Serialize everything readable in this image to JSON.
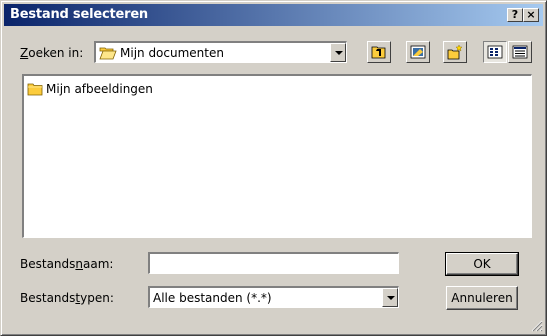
{
  "window": {
    "title": "Bestand selecteren",
    "help_button": "?",
    "close_button": "×"
  },
  "lookin": {
    "label_prefix": "",
    "label_accel": "Z",
    "label_rest": "oeken in:",
    "value": "Mijn documenten",
    "icon": "folder-open-icon"
  },
  "toolbar": {
    "up_icon": "up-folder-icon",
    "desktop_icon": "desktop-icon",
    "new_folder_icon": "new-folder-icon",
    "list_icon": "list-view-icon",
    "details_icon": "details-view-icon"
  },
  "files": [
    {
      "name": "Mijn afbeeldingen",
      "icon": "folder-icon"
    }
  ],
  "filename": {
    "label_prefix": "Bestands",
    "label_accel": "n",
    "label_rest": "aam:",
    "value": ""
  },
  "filetype": {
    "label_prefix": "Bestands",
    "label_accel": "t",
    "label_rest": "ypen:",
    "value": "Alle bestanden (*.*)"
  },
  "buttons": {
    "ok": "OK",
    "cancel": "Annuleren"
  },
  "colors": {
    "title_start": "#0a246a",
    "title_end": "#a6caf0",
    "face": "#d4d0c8",
    "folder": "#fccc3c"
  }
}
